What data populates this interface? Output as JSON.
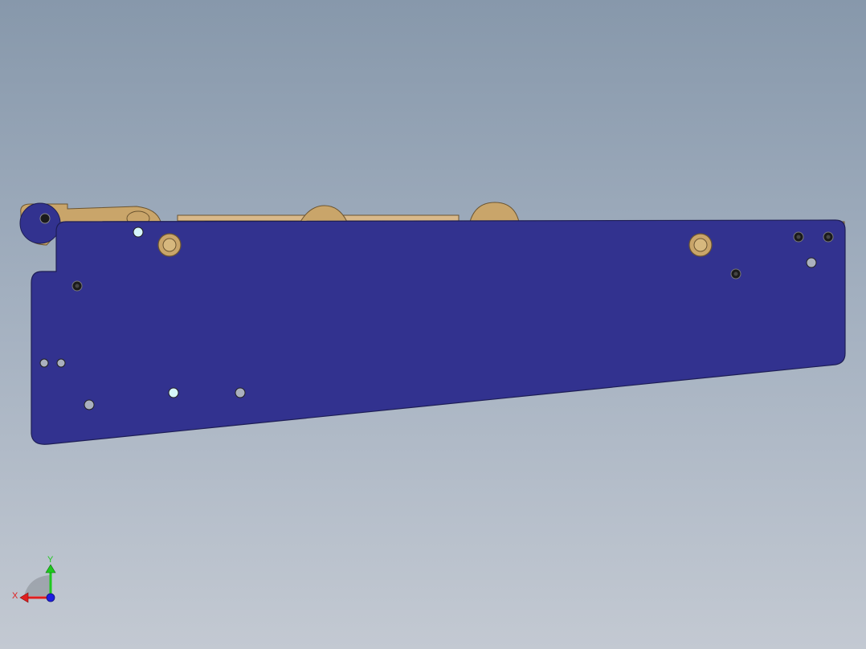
{
  "viewport": {
    "background_top": "#8798ab",
    "background_bottom": "#c3c9d2"
  },
  "model": {
    "plate_color": "#32328f",
    "plate_edge_color": "#1e1e55",
    "bronze_color": "#c9a56a",
    "bronze_edge_color": "#6b5430",
    "hole_gray": "#aab0be",
    "hole_cyan": "#d6f6fb",
    "screw_color": "#1a1a1a"
  },
  "triad": {
    "x_label": "X",
    "y_label": "Y",
    "x_color": "#e01e1e",
    "y_color": "#1ec81e",
    "z_color": "#1e1ee0"
  }
}
